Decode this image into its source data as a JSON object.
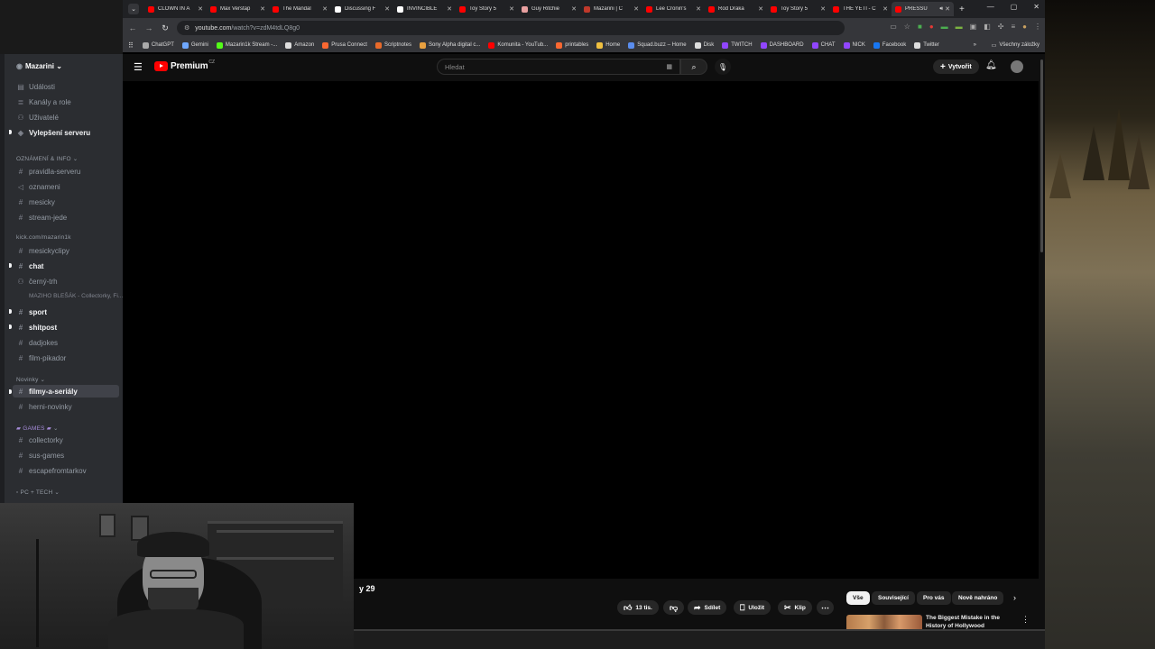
{
  "browser": {
    "tabs": [
      {
        "label": "CLOWN IN A",
        "color": "#ff0000"
      },
      {
        "label": "Max Verstap",
        "color": "#ff0000"
      },
      {
        "label": "The Mandal",
        "color": "#ff0000"
      },
      {
        "label": "Discussing F",
        "color": "#ffffff"
      },
      {
        "label": "INVINCIBLE",
        "color": "#ffffff"
      },
      {
        "label": "Toy Story 5",
        "color": "#ff0000"
      },
      {
        "label": "Guy Ritchie",
        "color": "#e8a0a0"
      },
      {
        "label": "Mazarini | C",
        "color": "#c0392b"
      },
      {
        "label": "Lee Cronin's",
        "color": "#ff0000"
      },
      {
        "label": "Rod Draka",
        "color": "#ff0000"
      },
      {
        "label": "Toy Story 5",
        "color": "#ff0000"
      },
      {
        "label": "THE YETI - C",
        "color": "#ff0000"
      },
      {
        "label": "PRESSU",
        "color": "#ff0000",
        "active": true
      }
    ],
    "url": {
      "host": "youtube.com",
      "path": "/watch?v=zdM4tdLQ8g0"
    },
    "bookmarks": [
      {
        "label": "ChatGPT",
        "color": "#aaaaaa"
      },
      {
        "label": "Gemini",
        "color": "#6fa8ff"
      },
      {
        "label": "Mazarin1k Stream -...",
        "color": "#53fc18"
      },
      {
        "label": "Amazon",
        "color": "#dddddd"
      },
      {
        "label": "Prusa Connect",
        "color": "#fa6831"
      },
      {
        "label": "Scriptnotes",
        "color": "#e86a2a"
      },
      {
        "label": "Sony Alpha digital c...",
        "color": "#e8a040"
      },
      {
        "label": "Komunita - YouTub...",
        "color": "#ff0000"
      },
      {
        "label": "printables",
        "color": "#fa6831"
      },
      {
        "label": "Home",
        "color": "#f0c040"
      },
      {
        "label": "Squad.buzz – Home",
        "color": "#5a8dee"
      },
      {
        "label": "Disk",
        "color": "#dddddd"
      },
      {
        "label": "TWITCH",
        "color": "#9146ff"
      },
      {
        "label": "DASHBOARD",
        "color": "#9146ff"
      },
      {
        "label": "CHAT",
        "color": "#9146ff"
      },
      {
        "label": "NICK",
        "color": "#9146ff"
      },
      {
        "label": "Facebook",
        "color": "#1877f2"
      },
      {
        "label": "Twitter",
        "color": "#dddddd"
      }
    ],
    "other_bookmarks": "Všechny záložky"
  },
  "discord": {
    "server": "Mazarini",
    "top_items": [
      "Události",
      "Kanály a role",
      "Uživatelé"
    ],
    "boost": "Vylepšení serveru",
    "cat1": "OZNÁMENÍ & INFO",
    "cat1_items": [
      "pravidla-serveru",
      "oznameni",
      "mesicky",
      "stream-jede"
    ],
    "cat2": "kick.com/mazarin1k",
    "cat2_items": [
      "mesickyclipy",
      "chat",
      "černý-trh"
    ],
    "thread": "MAZIHO BLEŠÁK - Collectorky, Fi...",
    "cat2b_items": [
      "sport",
      "shitpost",
      "dadjokes",
      "film-pikador"
    ],
    "cat3": "Novinky",
    "cat3_items": [
      "filmy-a-seriály",
      "herni-novinky"
    ],
    "cat4": "GAMES",
    "cat4_items": [
      "collectorky",
      "sus-games",
      "escapefromtarkov"
    ],
    "cat5": "PC + TECH"
  },
  "youtube": {
    "logo_word": "Premium",
    "logo_region": "CZ",
    "search_placeholder": "Hledat",
    "create_label": "Vytvořit",
    "subcount_fragment": "y 29",
    "like_count": "13 tis.",
    "share_label": "Sdílet",
    "save_label": "Uložit",
    "clip_label": "Klip",
    "chips": [
      "Vše",
      "Související",
      "Pro vás",
      "Nově nahráno"
    ],
    "rec_title": "The Biggest Mistake in the History of Hollywood"
  }
}
